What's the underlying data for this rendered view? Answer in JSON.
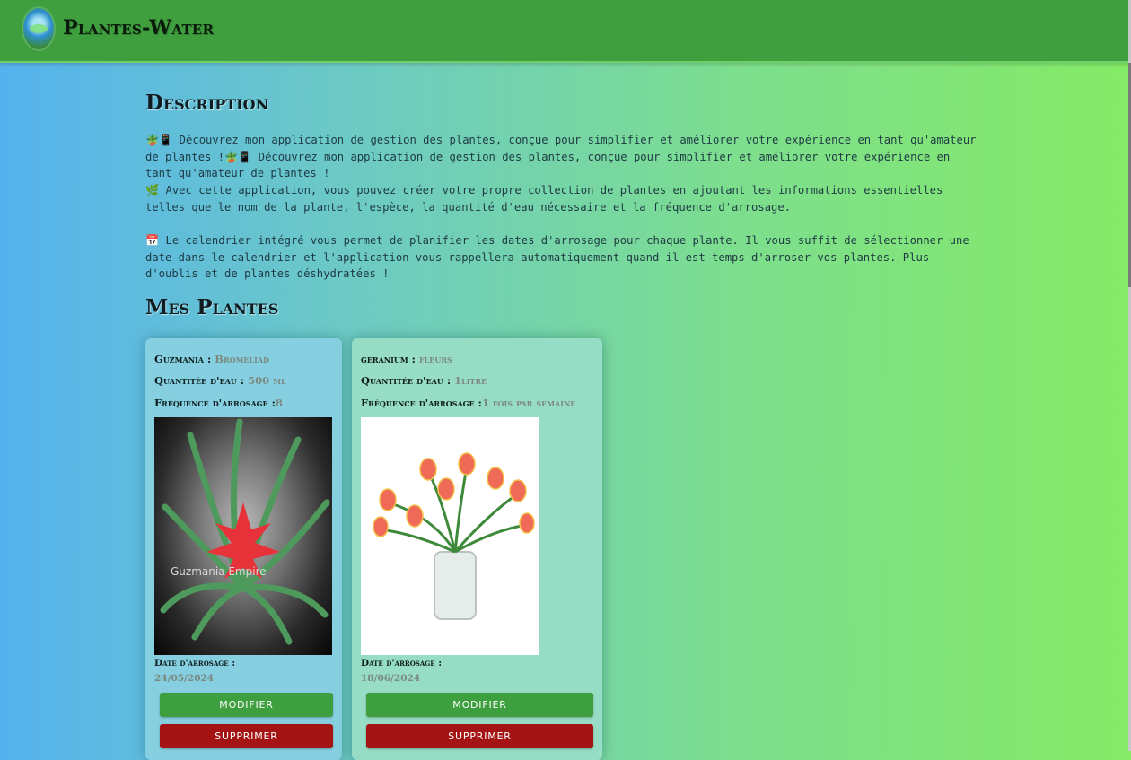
{
  "header": {
    "brand": "Plantes-Water",
    "logo_icon": "globe-leaf-logo-icon"
  },
  "description": {
    "title": "Description",
    "p1": "🪴📱 Découvrez mon application de gestion des plantes, conçue pour simplifier et améliorer votre expérience en tant qu'amateur de plantes !🪴📱 Découvrez mon application de gestion des plantes, conçue pour simplifier et améliorer votre expérience en tant qu'amateur de plantes !",
    "p2": "🌿 Avec cette application, vous pouvez créer votre propre collection de plantes en ajoutant les informations essentielles telles que le nom de la plante, l'espèce, la quantité d'eau nécessaire et la fréquence d'arrosage.",
    "p3": "📅 Le calendrier intégré vous permet de planifier les dates d'arrosage pour chaque plante. Il vous suffit de sélectionner une date dans le calendrier et l'application vous rappellera automatiquement quand il est temps d'arroser vos plantes. Plus d'oublis et de plantes déshydratées !"
  },
  "plants_section": {
    "title": "Mes Plantes"
  },
  "plants": [
    {
      "name": "Guzmania :",
      "species": "Bromeliad",
      "water_label": "Quantitée d'eau :",
      "water": "500 ml",
      "freq_label": "Fréquence d'arrosage :",
      "freq": "8",
      "image": "guzmania-bromeliad-photo",
      "image_caption": "Guzmania Empire",
      "date_label": "Date d'arrosage :",
      "date": "24/05/2024",
      "modify_label": "MODIFIER",
      "delete_label": "SUPPRIMER"
    },
    {
      "name": "geranium :",
      "species": "fleurs",
      "water_label": "Quantitée d'eau :",
      "water": "1litre",
      "freq_label": "Fréquence d'arrosage :",
      "freq": "1 fois par semaine",
      "image": "tulip-bouquet-vase-photo",
      "date_label": "Date d'arrosage :",
      "date": "18/06/2024",
      "modify_label": "MODIFIER",
      "delete_label": "SUPPRIMER"
    }
  ],
  "colors": {
    "header": "#3f9f3f",
    "modify_button": "#3e9f3e",
    "delete_button": "#a51414",
    "card_1": "#86cfe0",
    "card_2": "#97dcc4"
  }
}
